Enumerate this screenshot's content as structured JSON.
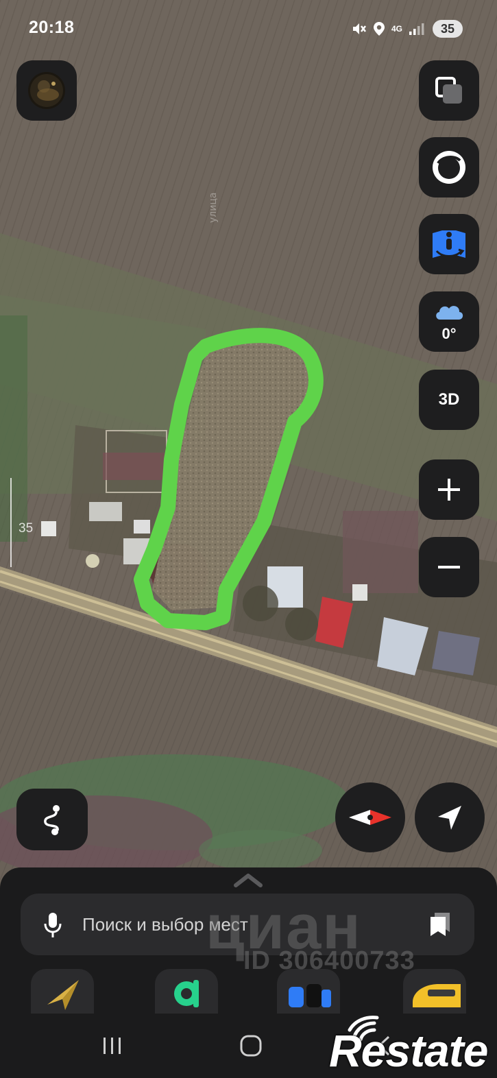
{
  "status_bar": {
    "time": "20:18",
    "network": "4G",
    "battery": "35"
  },
  "map": {
    "scale_label": "35",
    "highlight_color": "#5fd34a"
  },
  "controls": {
    "threed_label": "3D",
    "weather_temp": "0°",
    "zoom_in": "+",
    "zoom_out": "−"
  },
  "search": {
    "placeholder": "Поиск и выбор мест"
  },
  "watermark": {
    "brand": "циан",
    "id": "ID 306400733",
    "logo": "Restate"
  },
  "colors": {
    "panel": "#1e1e1f",
    "accent_blue": "#2f7cf6",
    "compass_red": "#e8322b"
  }
}
